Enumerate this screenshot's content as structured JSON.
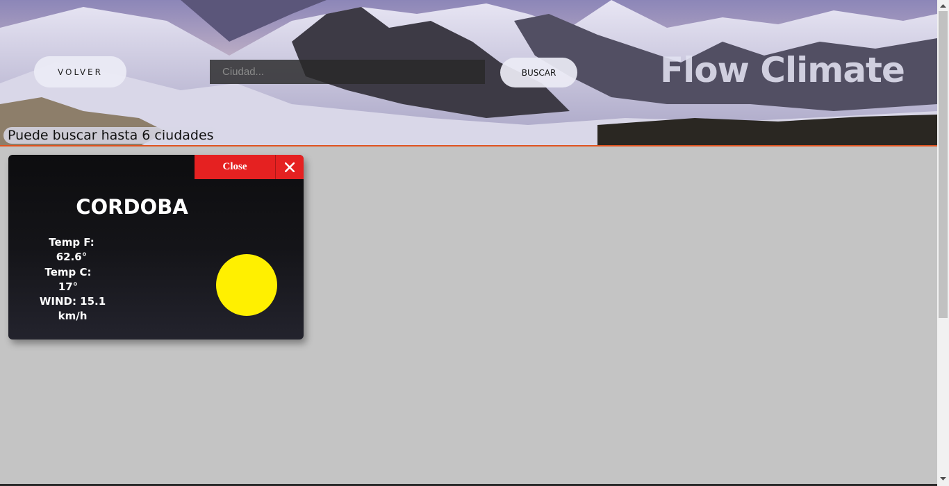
{
  "header": {
    "back_label": "VOLVER",
    "search_placeholder": "Ciudad...",
    "search_value": "",
    "search_label": "BUSCAR",
    "brand": "Flow Climate",
    "hint": "Puede buscar hasta 6 ciudades"
  },
  "card": {
    "close_label": "Close",
    "close_icon": "close-icon",
    "city": "CORDOBA",
    "temp_f": "Temp F: 62.6°",
    "temp_c": "Temp C: 17°",
    "wind_line1": "WIND: 15.1",
    "wind_line2": "km/h",
    "weather_icon": "sun-icon"
  },
  "colors": {
    "page_bg": "#c4c4c4",
    "accent_red": "#e52121",
    "sun_yellow": "#fff000",
    "header_border": "#e0531f",
    "card_bg": "#0d0d0f"
  }
}
